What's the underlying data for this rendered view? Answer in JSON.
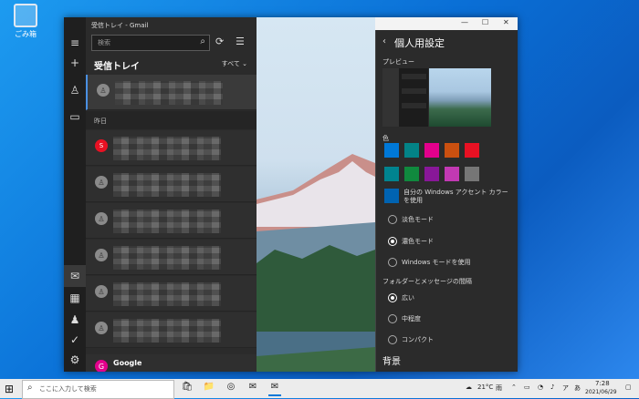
{
  "desktop": {
    "recycle_bin_label": "ごみ箱"
  },
  "window": {
    "title": "受信トレイ - Gmail"
  },
  "mail": {
    "search_placeholder": "検索",
    "inbox_title": "受信トレイ",
    "filter_label": "すべて",
    "date_header": "昨日",
    "last_sender": "Google"
  },
  "settings": {
    "title": "個人用設定",
    "preview_label": "プレビュー",
    "color_label": "色",
    "accent_option": "自分の Windows アクセント カラーを使用",
    "theme_options": [
      "淡色モード",
      "濃色モード",
      "Windows モードを使用"
    ],
    "theme_selected": "濃色モード",
    "spacing_label": "フォルダーとメッセージの間隔",
    "spacing_options": [
      "広い",
      "中程度",
      "コンパクト"
    ],
    "spacing_selected": "広い",
    "background_label": "背景",
    "swatches": [
      "#0078d7",
      "#038387",
      "#e3008c",
      "#ca5010",
      "#e81123",
      "#00838f",
      "#10893e",
      "#881798",
      "#c239b3",
      "#767676",
      "#0063b1"
    ]
  },
  "taskbar": {
    "search_placeholder": "ここに入力して検索",
    "temperature": "21°C",
    "weather_text": "雨",
    "ime_label": "あ",
    "time": "7:28",
    "date": "2021/06/29"
  }
}
